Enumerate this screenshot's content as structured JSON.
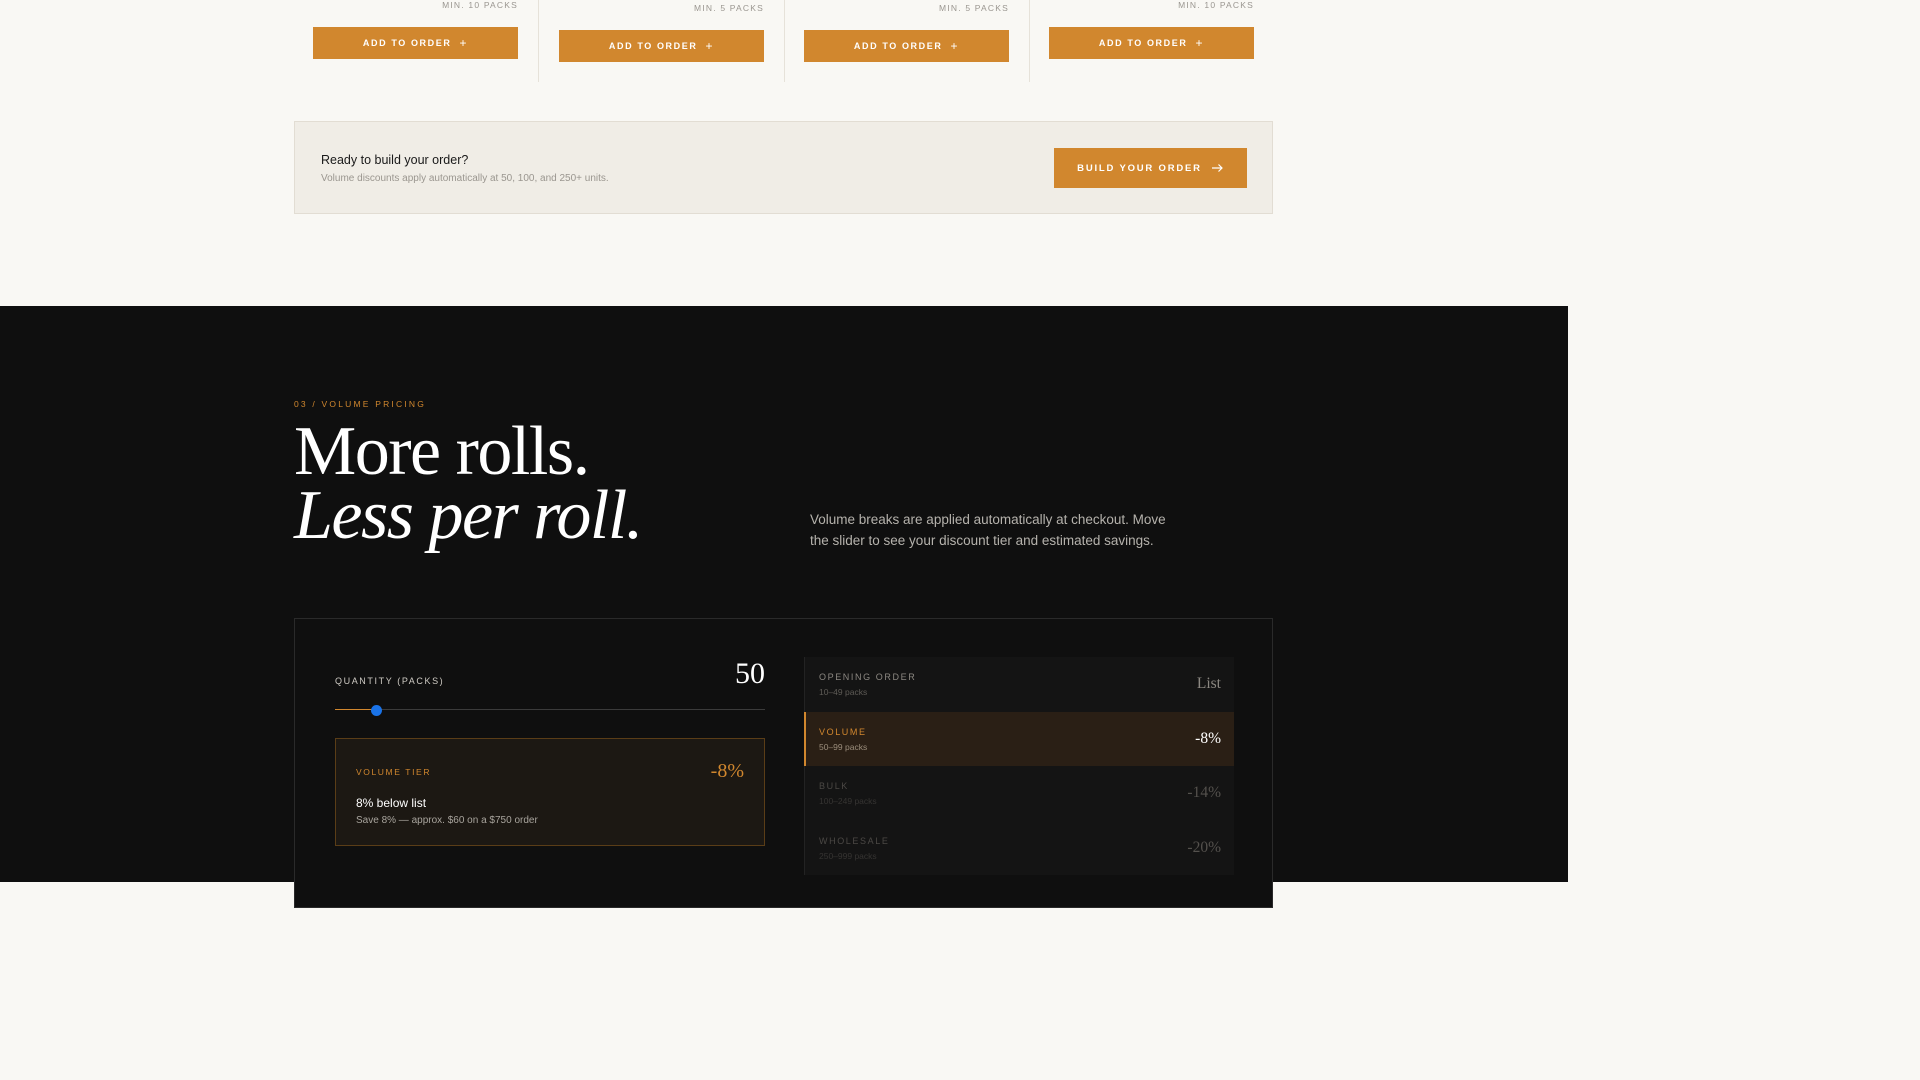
{
  "products": [
    {
      "min_label": "MIN. 10 PACKS",
      "button_label": "ADD TO ORDER"
    },
    {
      "min_label": "MIN. 5 PACKS",
      "button_label": "ADD TO ORDER"
    },
    {
      "min_label": "MIN. 5 PACKS",
      "button_label": "ADD TO ORDER"
    },
    {
      "min_label": "MIN. 10 PACKS",
      "button_label": "ADD TO ORDER"
    }
  ],
  "cta": {
    "title": "Ready to build your order?",
    "subtitle": "Volume discounts apply automatically at 50, 100, and 250+ units.",
    "button_label": "BUILD YOUR ORDER"
  },
  "volume": {
    "eyebrow": "03 / VOLUME PRICING",
    "headline_line1": "More rolls.",
    "headline_line2": "Less per roll.",
    "intro": "Volume breaks are applied automatically at checkout. Move the slider to see your discount tier and estimated savings."
  },
  "calculator": {
    "quantity_label": "QUANTITY (PACKS)",
    "quantity_value": "50",
    "slider_fraction": 0.095,
    "tier_card": {
      "eyebrow": "VOLUME TIER",
      "discount": "-8%",
      "title": "8% below list",
      "subtitle": "Save 8% — approx. $60 on a $750 order"
    },
    "tiers": [
      {
        "name": "OPENING ORDER",
        "range": "10–49 packs",
        "discount": "List"
      },
      {
        "name": "VOLUME",
        "range": "50–99 packs",
        "discount": "-8%"
      },
      {
        "name": "BULK",
        "range": "100–249 packs",
        "discount": "-14%"
      },
      {
        "name": "WHOLESALE",
        "range": "250–999 packs",
        "discount": "-20%"
      }
    ],
    "active_tier": "VOLUME"
  },
  "colors": {
    "accent": "#d1872e",
    "dark_bg": "#0f0f0f",
    "light_bg": "#f9f8f4",
    "slider_thumb": "#1a73e8"
  }
}
